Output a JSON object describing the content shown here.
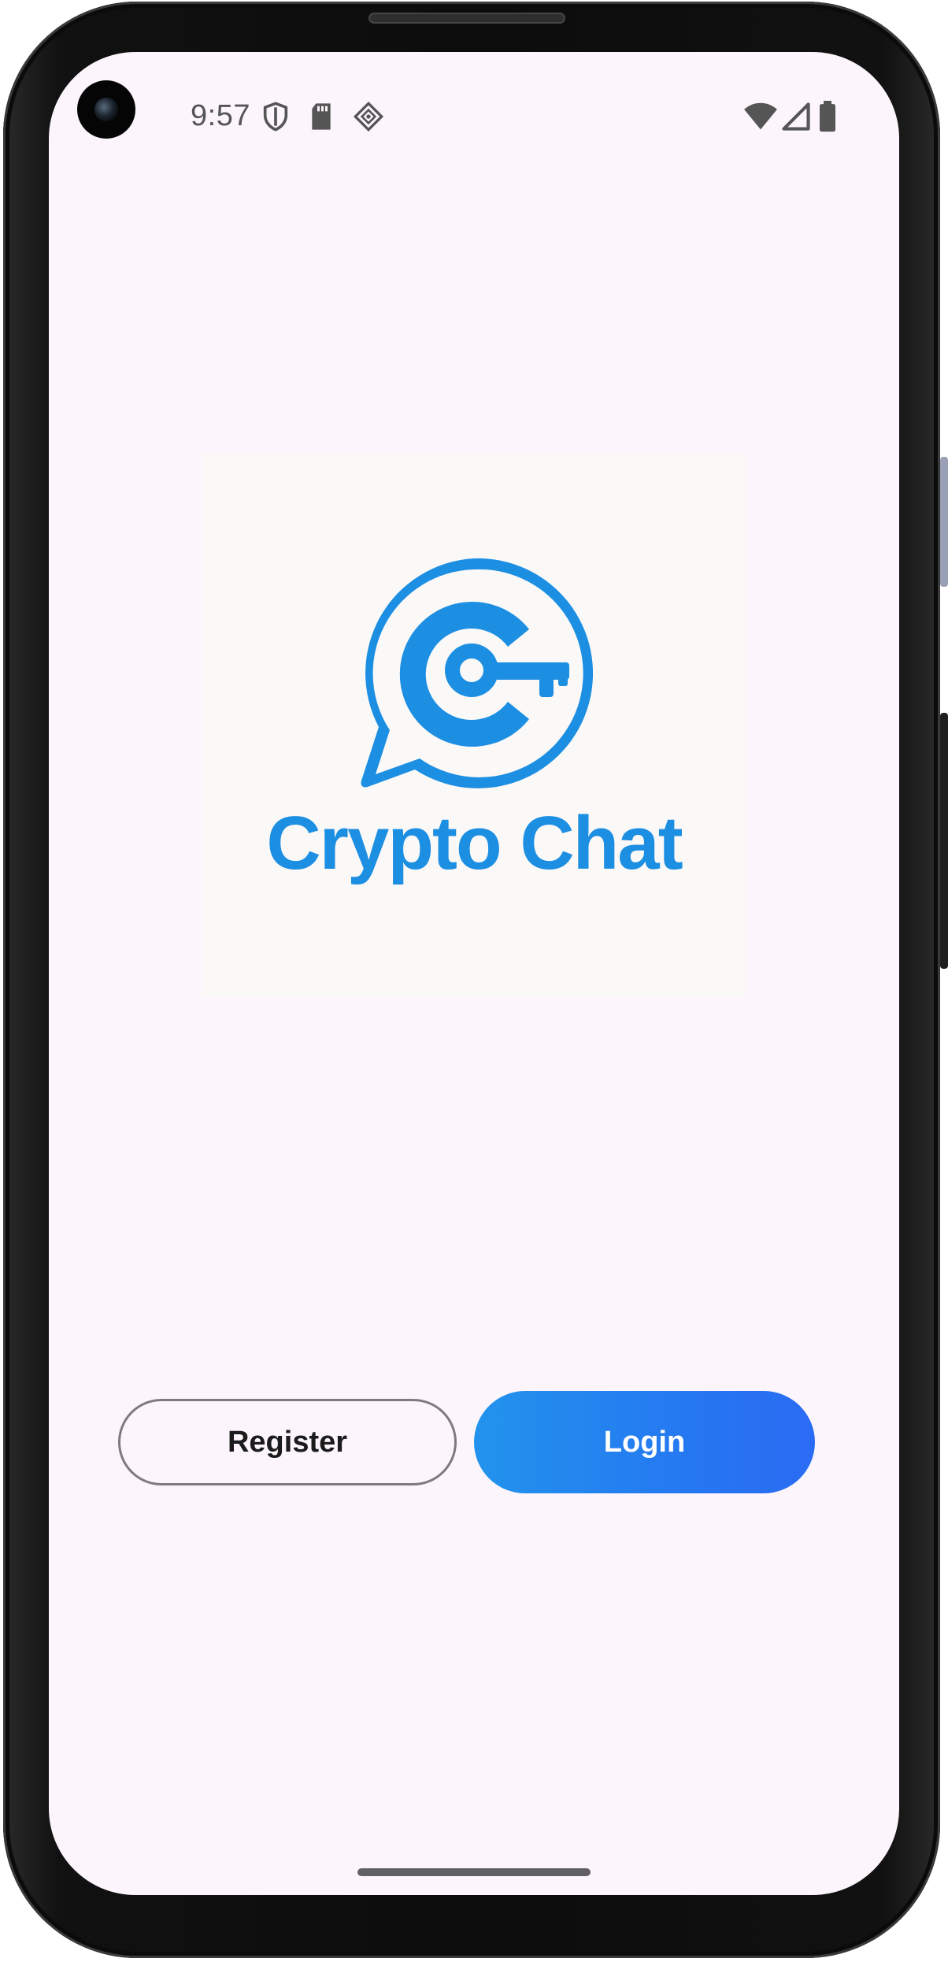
{
  "status_bar": {
    "time": "9:57",
    "left_icons": [
      "shield-icon",
      "sd-card-icon",
      "data-saver-icon"
    ],
    "right_icons": [
      "wifi-icon",
      "cell-signal-icon",
      "battery-icon"
    ]
  },
  "logo": {
    "text": "Crypto Chat",
    "icon": "chat-key-logo-icon",
    "brand_color": "#1d8fe3"
  },
  "actions": {
    "register_label": "Register",
    "login_label": "Login"
  },
  "colors": {
    "screen_background": "#fcf5fb",
    "login_gradient_start": "#2293ec",
    "login_gradient_end": "#2a6bf3",
    "register_border": "#7d7a80"
  }
}
